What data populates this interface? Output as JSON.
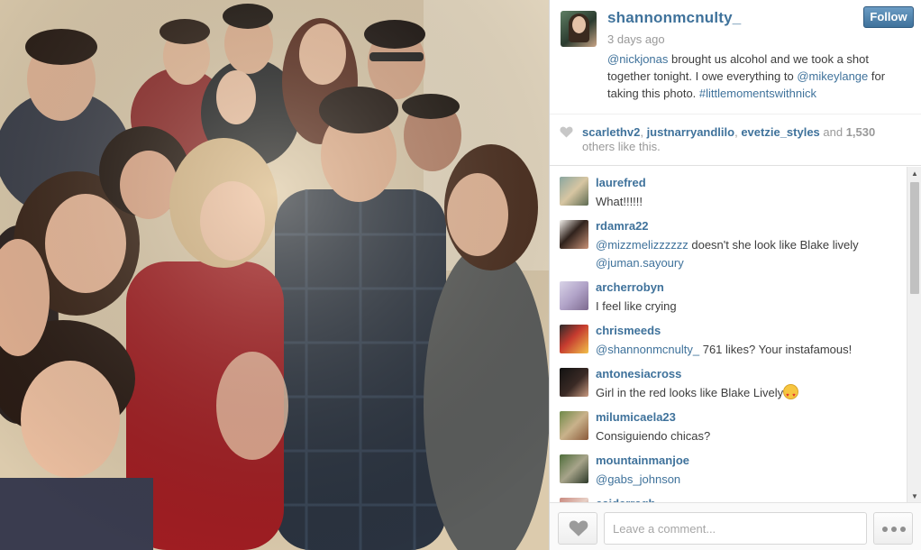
{
  "post": {
    "owner": "shannonmcnulty_",
    "follow_label": "Follow",
    "time_ago": "3 days ago",
    "caption": {
      "mention1": "@nickjonas",
      "text1": " brought us alcohol and we took a shot together tonight. I owe everything to ",
      "mention2": "@mikeylange",
      "text2": " for taking this photo. ",
      "hashtag": "#littlemomentswithnick"
    }
  },
  "likes": {
    "user1": "scarlethv2",
    "sep1": ", ",
    "user2": "justnarryandlilo",
    "sep2": ", ",
    "user3": "evetzie_styles",
    "and_text": " and ",
    "count": "1,530",
    "suffix": " others like this."
  },
  "comments": [
    {
      "user": "laurefred",
      "text": "What!!!!!!"
    },
    {
      "user": "rdamra22",
      "mention": "@mizzmelizzzzzz",
      "text": " doesn't she look like Blake lively ",
      "mention2": "@juman.sayoury"
    },
    {
      "user": "archerrobyn",
      "text": "I feel like crying"
    },
    {
      "user": "chrismeeds",
      "mention": "@shannonmcnulty_",
      "text": " 761 likes? Your instafamous!"
    },
    {
      "user": "antonesiacross",
      "text": "Girl in the red looks like Blake Lively",
      "emoji": "heart-eyes-emoji"
    },
    {
      "user": "milumicaela23",
      "text": "Consiguiendo chicas?"
    },
    {
      "user": "mountainmanjoe",
      "mention": "@gabs_johnson"
    },
    {
      "user": "caiderragh"
    }
  ],
  "footer": {
    "comment_placeholder": "Leave a comment..."
  },
  "icons": {
    "like": "heart-icon",
    "more": "ellipsis-icon",
    "scroll_up": "arrow-up-icon",
    "scroll_down": "arrow-down-icon"
  },
  "colors": {
    "link": "#3f729b",
    "follow_button": "#3f729b",
    "text": "#3d3d3d",
    "muted": "#999999"
  }
}
